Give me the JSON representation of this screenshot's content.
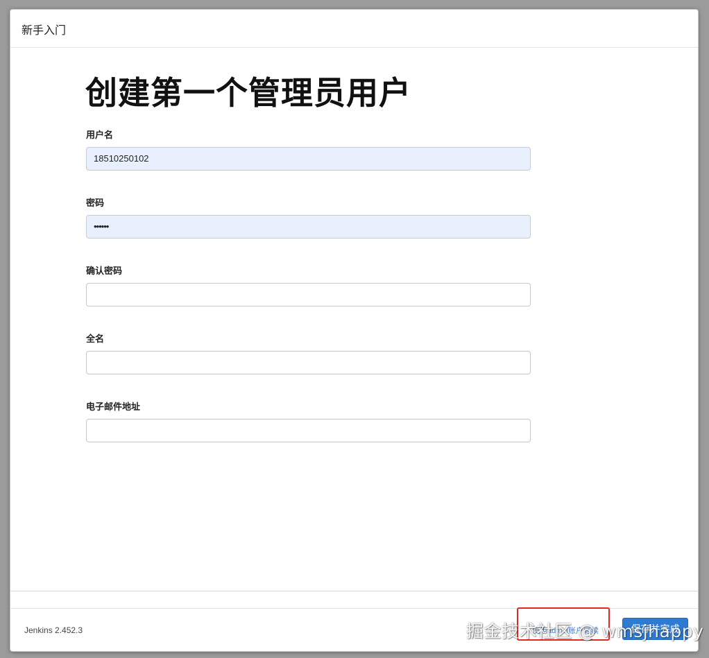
{
  "dialog": {
    "title": "新手入门"
  },
  "page": {
    "title": "创建第一个管理员用户"
  },
  "form": {
    "fields": [
      {
        "label": "用户名",
        "value": "18510250102",
        "placeholder": ""
      },
      {
        "label": "密码",
        "value": "••••••",
        "placeholder": ""
      },
      {
        "label": "确认密码",
        "value": "",
        "placeholder": ""
      },
      {
        "label": "全名",
        "value": "",
        "placeholder": ""
      },
      {
        "label": "电子邮件地址",
        "value": "",
        "placeholder": ""
      }
    ]
  },
  "footer": {
    "version": "Jenkins 2.452.3",
    "skip_link_label": "使用admin账户继续",
    "primary_button_label": "保存并完成"
  },
  "watermark": {
    "text": "掘金技术社区 @ wmsjhappy"
  },
  "colors": {
    "primary": "#2e7bd1",
    "autofill_background": "#e8f0fe",
    "highlight": "#e02a1f"
  }
}
